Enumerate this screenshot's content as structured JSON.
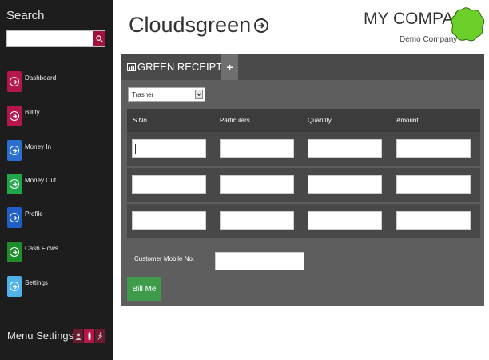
{
  "sidebar": {
    "search_label": "Search",
    "search_placeholder": "",
    "items": [
      {
        "label": "Dashboard",
        "icon": "arrow-right-circle-icon",
        "color": "#b5174b"
      },
      {
        "label": "Billify",
        "icon": "arrow-right-circle-icon",
        "color": "#b5174b"
      },
      {
        "label": "Money In",
        "icon": "arrow-right-circle-icon",
        "color": "#2a6fd0"
      },
      {
        "label": "Money Out",
        "icon": "arrow-right-circle-icon",
        "color": "#1fa64a"
      },
      {
        "label": "Profile",
        "icon": "arrow-right-circle-icon",
        "color": "#1f5fc7"
      },
      {
        "label": "Cash Flows",
        "icon": "arrow-right-circle-icon",
        "color": "#1f8e2a"
      },
      {
        "label": "Settings",
        "icon": "arrow-right-circle-icon",
        "color": "#4fb3e8"
      }
    ],
    "menu_settings_label": "Menu Settings"
  },
  "header": {
    "brand": "Cloudsgreen",
    "company_name": "MY COMPANY",
    "company_sub": "Demo Company"
  },
  "receipt": {
    "tab_label": "GREEN RECEIPT",
    "add_tab_label": "+",
    "selected_option": "Trasher",
    "columns": [
      "S.No",
      "Particulars",
      "Quantity",
      "Amount"
    ],
    "rows": [
      [
        "",
        "",
        "",
        ""
      ],
      [
        "",
        "",
        "",
        ""
      ],
      [
        "",
        "",
        "",
        ""
      ]
    ],
    "mobile_label": "Customer Mobile No.",
    "mobile_value": "",
    "bill_button": "Bill Me"
  },
  "colors": {
    "accent_red": "#a3123c",
    "accent_green": "#3d9b49",
    "logo_green": "#6ccf2a"
  }
}
